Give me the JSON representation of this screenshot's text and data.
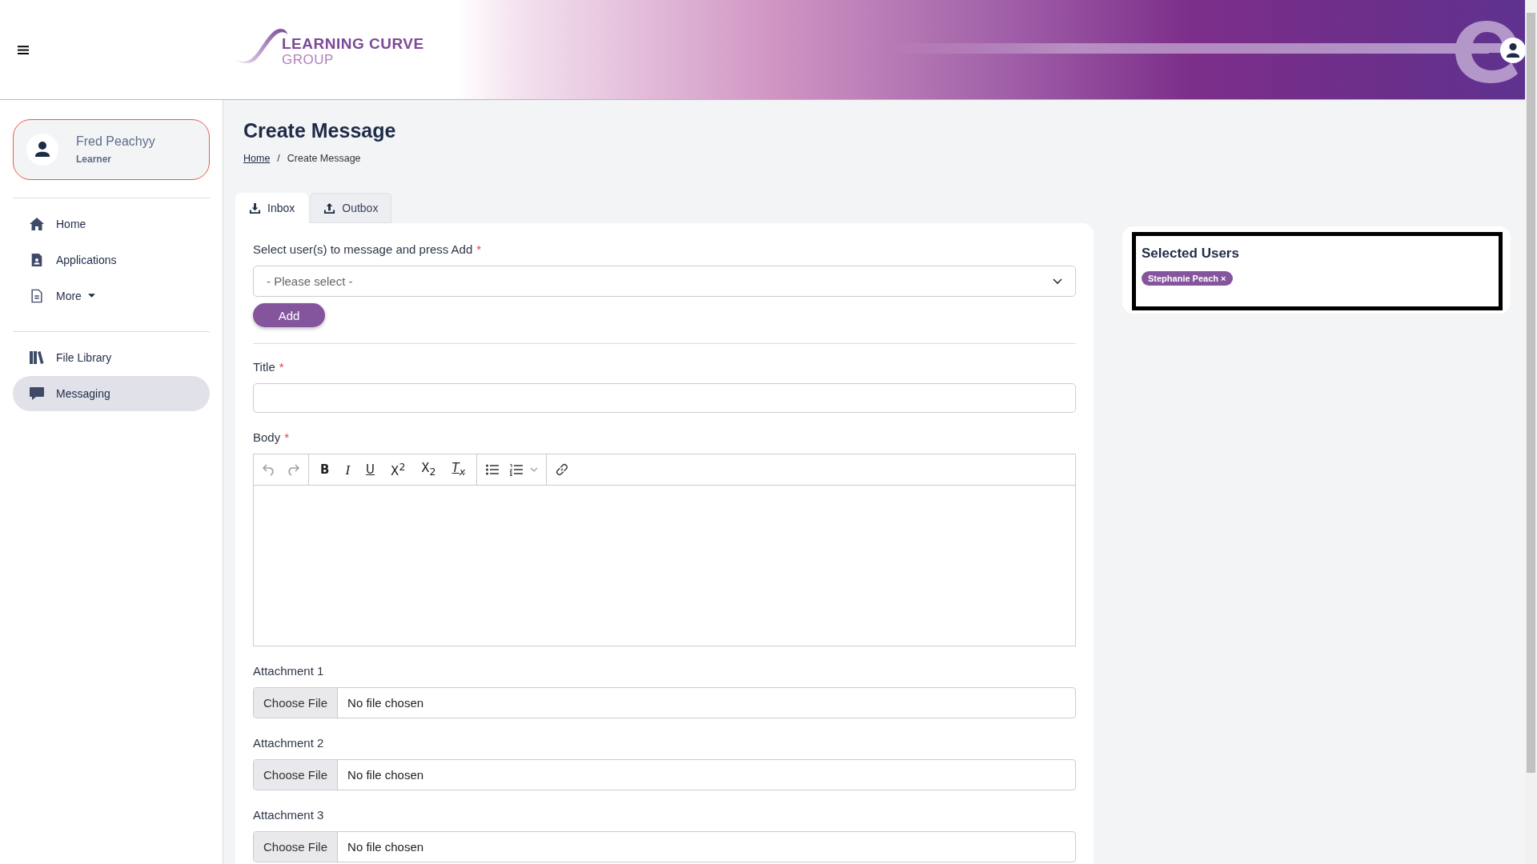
{
  "header": {
    "logo_line1": "LEARNING CURVE",
    "logo_line2": "GROUP"
  },
  "profile": {
    "name": "Fred Peachyy",
    "role": "Learner"
  },
  "sidebar": {
    "groups": [
      [
        {
          "label": "Home",
          "selected": false,
          "has_menu": false
        },
        {
          "label": "Applications",
          "selected": false,
          "has_menu": false
        },
        {
          "label": "More",
          "selected": false,
          "has_menu": true
        }
      ],
      [
        {
          "label": "File Library",
          "selected": false,
          "has_menu": false
        },
        {
          "label": "Messaging",
          "selected": true,
          "has_menu": false
        }
      ]
    ]
  },
  "page": {
    "title": "Create Message",
    "breadcrumb": [
      {
        "label": "Home",
        "kind": "link"
      },
      {
        "label": "/",
        "kind": "separator"
      },
      {
        "label": "Create Message",
        "kind": "current"
      }
    ]
  },
  "tabs": [
    {
      "label": "Inbox",
      "selected": true
    },
    {
      "label": "Outbox",
      "selected": false
    }
  ],
  "form": {
    "select_users": {
      "label": "Select user(s) to message and press Add",
      "required": "*",
      "placeholder": "- Please select -"
    },
    "add_button": "Add",
    "title": {
      "label": "Title",
      "required": "*"
    },
    "body": {
      "label": "Body",
      "required": "*"
    },
    "format_buttons": [
      "B",
      "I",
      "U",
      "X$^{2}$",
      "X$_{2}$",
      "T$_{x}$"
    ],
    "attachments": [
      {
        "label": "Attachment 1",
        "button": "Choose File",
        "status": "No file chosen"
      },
      {
        "label": "Attachment 2",
        "button": "Choose File",
        "status": "No file chosen"
      },
      {
        "label": "Attachment 3",
        "button": "Choose File",
        "status": "No file chosen"
      }
    ]
  },
  "selected_users": {
    "title": "Selected Users",
    "users": [
      {
        "name": "Stephanie Peach",
        "remove": "×"
      }
    ]
  }
}
